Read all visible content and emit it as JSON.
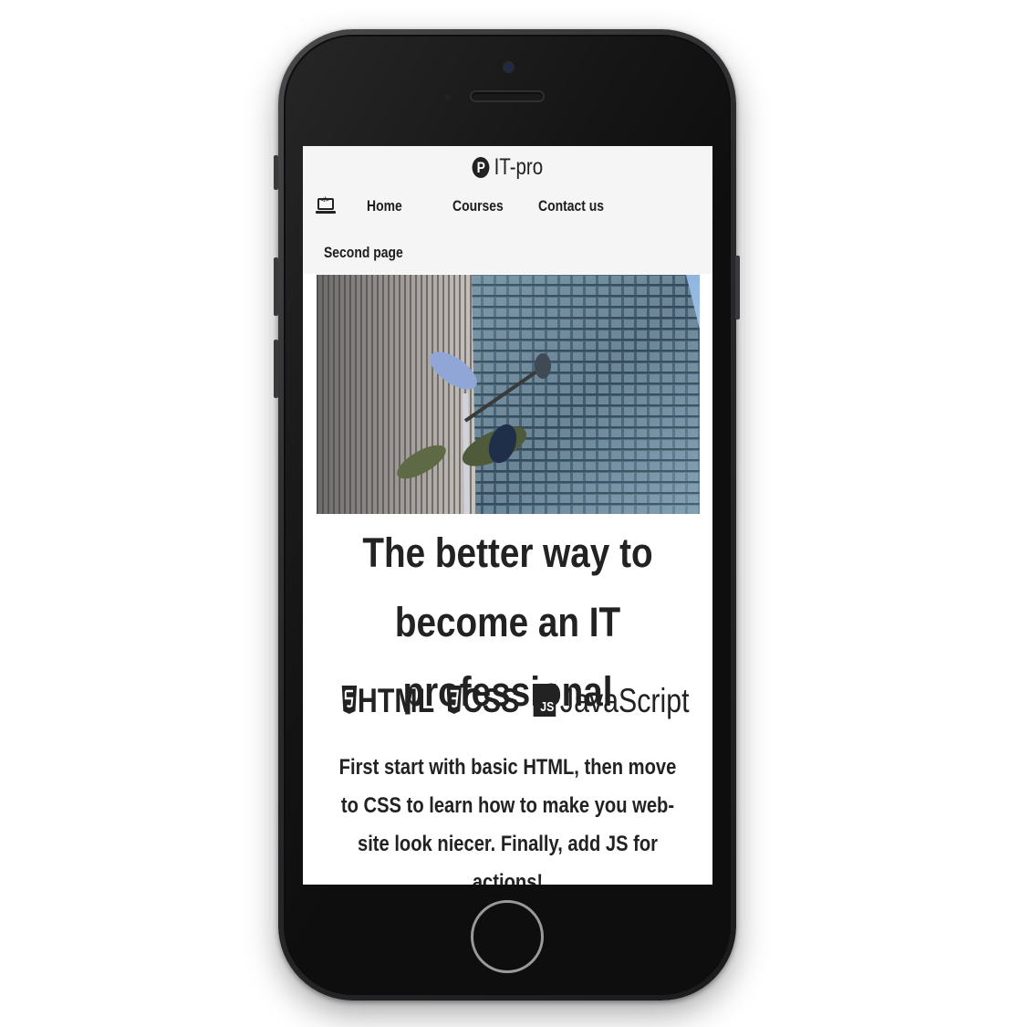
{
  "brand": {
    "logo_letter": "P",
    "name": "IT-pro"
  },
  "nav": {
    "items": [
      {
        "label": "Home"
      },
      {
        "label": "Courses"
      },
      {
        "label": "Contact us"
      },
      {
        "label": "Second page"
      }
    ],
    "icon": "laptop-code-icon"
  },
  "hero": {
    "image": "skyscraper-photo",
    "headline": "The better way to become an IT professional"
  },
  "tech": {
    "html_label": "HTML",
    "css_label": "CSS",
    "js_badge": "JS",
    "js_label": "JavaScript"
  },
  "intro": {
    "text": "First start with basic HTML, then move to CSS to learn how to make you web-site look niecer. Finally, add JS for actions!"
  },
  "colors": {
    "header_bg": "#f5f5f5",
    "text": "#222222",
    "phone_body": "#1c1c1e"
  }
}
